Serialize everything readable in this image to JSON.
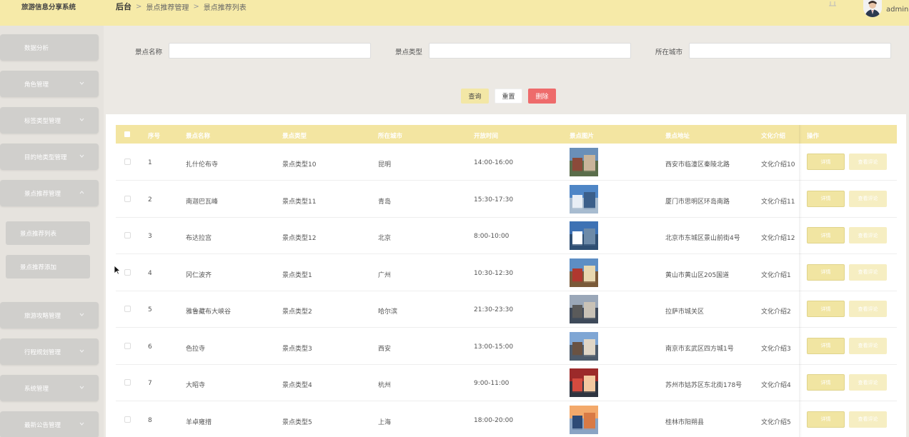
{
  "app": {
    "title": "旅游信息分享系统",
    "username": "admin"
  },
  "breadcrumb": {
    "root": "后台",
    "items": [
      "景点推荐管理",
      "景点推荐列表"
    ]
  },
  "sidebar": {
    "items": [
      {
        "label": "数据分析"
      },
      {
        "label": "角色管理"
      },
      {
        "label": "标签类型管理"
      },
      {
        "label": "目的地类型管理"
      },
      {
        "label": "景点推荐管理"
      },
      {
        "label": "旅游攻略管理"
      },
      {
        "label": "行程规划管理"
      },
      {
        "label": "系统管理"
      },
      {
        "label": "最新公告管理"
      }
    ],
    "subitems": [
      {
        "label": "景点推荐列表"
      },
      {
        "label": "景点推荐添加"
      }
    ]
  },
  "search": {
    "fields": [
      {
        "label": "景点名称",
        "value": ""
      },
      {
        "label": "景点类型",
        "value": ""
      },
      {
        "label": "所在城市",
        "value": ""
      }
    ],
    "buttons": {
      "query": "查询",
      "reset": "重置",
      "delete": "删除"
    }
  },
  "table": {
    "headers": [
      "序号",
      "景点名称",
      "景点类型",
      "所在城市",
      "开放时间",
      "景点图片",
      "景点地址",
      "文化介绍",
      "操作"
    ],
    "rows": [
      {
        "no": "1",
        "name": "扎什伦布寺",
        "type": "景点类型10",
        "city": "昆明",
        "time": "14:00-16:00",
        "address": "西安市临潼区秦陵北路",
        "culture": "文化介绍10"
      },
      {
        "no": "2",
        "name": "南迦巴瓦峰",
        "type": "景点类型11",
        "city": "青岛",
        "time": "15:30-17:30",
        "address": "厦门市思明区环岛南路",
        "culture": "文化介绍11"
      },
      {
        "no": "3",
        "name": "布达拉宫",
        "type": "景点类型12",
        "city": "北京",
        "time": "8:00-10:00",
        "address": "北京市东城区景山前街4号",
        "culture": "文化介绍12"
      },
      {
        "no": "4",
        "name": "冈仁波齐",
        "type": "景点类型1",
        "city": "广州",
        "time": "10:30-12:30",
        "address": "黄山市黄山区205国道",
        "culture": "文化介绍1"
      },
      {
        "no": "5",
        "name": "雅鲁藏布大峡谷",
        "type": "景点类型2",
        "city": "哈尔滨",
        "time": "21:30-23:30",
        "address": "拉萨市城关区",
        "culture": "文化介绍2"
      },
      {
        "no": "6",
        "name": "色拉寺",
        "type": "景点类型3",
        "city": "西安",
        "time": "13:00-15:00",
        "address": "南京市玄武区四方城1号",
        "culture": "文化介绍3"
      },
      {
        "no": "7",
        "name": "大昭寺",
        "type": "景点类型4",
        "city": "杭州",
        "time": "9:00-11:00",
        "address": "苏州市姑苏区东北街178号",
        "culture": "文化介绍4"
      },
      {
        "no": "8",
        "name": "羊卓雍措",
        "type": "景点类型5",
        "city": "上海",
        "time": "18:00-20:00",
        "address": "桂林市阳朔县",
        "culture": "文化介绍5"
      }
    ],
    "actions": {
      "detail": "详情",
      "comment": "查看评论"
    }
  },
  "colors": {
    "header": "#f6eaa8",
    "accent": "#f3e5a1",
    "danger": "#ee6b6b",
    "sidebar_item": "#d0cfcc"
  },
  "icons": [
    "bell-icon",
    "avatar-icon",
    "chevron-down-icon",
    "chevron-up-icon",
    "mouse-cursor-icon",
    "thumbnail-photo"
  ]
}
